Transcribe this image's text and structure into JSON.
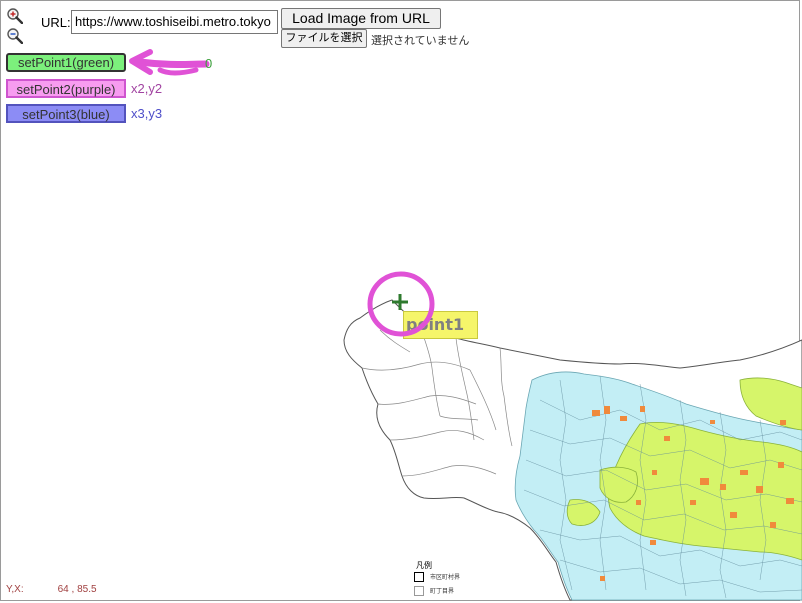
{
  "toolbar": {
    "url_label": "URL:",
    "url_value": "https://www.toshiseibi.metro.tokyo",
    "load_button": "Load Image from URL",
    "file_button": "ファイルを選択",
    "file_status": "選択されていません"
  },
  "points": [
    {
      "label": "setPoint1(green)",
      "value": "0",
      "color": "#7cf07c"
    },
    {
      "label": "setPoint2(purple)",
      "value": "x2,y2",
      "color": "#f79cf0"
    },
    {
      "label": "setPoint3(blue)",
      "value": "x3,y3",
      "color": "#8c8cf5"
    }
  ],
  "marker": {
    "label": "point1"
  },
  "status": {
    "label": "Y,X:",
    "value": "64 , 85.5"
  },
  "legend": {
    "title": "凡例",
    "items": [
      "市区町村界",
      "町丁目界"
    ]
  },
  "colors": {
    "map_cyan": "#c3eef5",
    "map_green": "#d6f56a",
    "map_orange": "#f08a3c",
    "annotation_pink": "#e052d6"
  }
}
